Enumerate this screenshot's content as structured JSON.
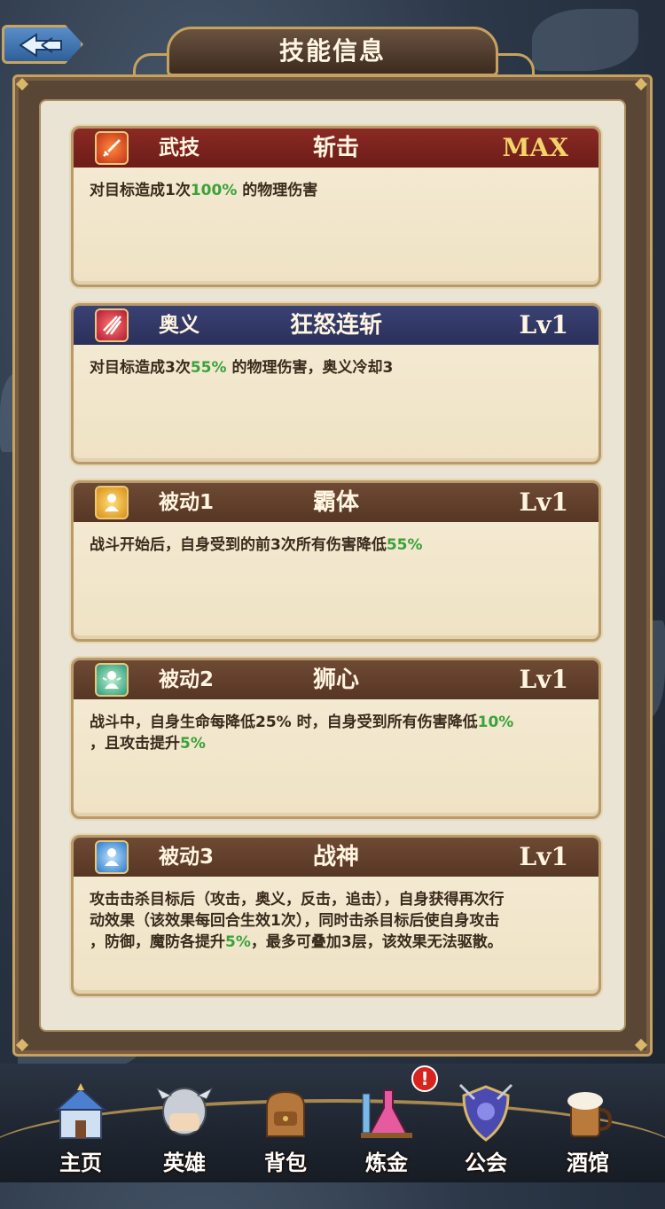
{
  "header": {
    "title": "技能信息"
  },
  "skills": [
    {
      "type": "武技",
      "name": "斩击",
      "level": "MAX",
      "header_color": "#7a221e",
      "icon": "sword-skill-icon",
      "desc": [
        {
          "t": "对目标造成1次"
        },
        {
          "t": "100%",
          "hl": true
        },
        {
          "t": " 的物理伤害"
        }
      ]
    },
    {
      "type": "奥义",
      "name": "狂怒连斩",
      "level": "Lv1",
      "header_color": "#323a68",
      "icon": "slash-skill-icon",
      "desc": [
        {
          "t": "对目标造成3次"
        },
        {
          "t": "55%",
          "hl": true
        },
        {
          "t": " 的物理伤害，奥义冷却3"
        }
      ]
    },
    {
      "type": "被动1",
      "name": "霸体",
      "level": "Lv1",
      "header_color": "#62402c",
      "icon": "super-armor-icon",
      "desc": [
        {
          "t": "战斗开始后，自身受到的前3次所有伤害降低"
        },
        {
          "t": "55%",
          "hl": true
        }
      ]
    },
    {
      "type": "被动2",
      "name": "狮心",
      "level": "Lv1",
      "header_color": "#62402c",
      "icon": "lion-heart-icon",
      "desc": [
        {
          "t": "战斗中，自身生命每降低25% 时，自身受到所有伤害降低"
        },
        {
          "t": "10%",
          "hl": true
        },
        {
          "t": "\n，且攻击提升"
        },
        {
          "t": "5%",
          "hl": true
        }
      ]
    },
    {
      "type": "被动3",
      "name": "战神",
      "level": "Lv1",
      "header_color": "#62402c",
      "icon": "war-god-icon",
      "desc": [
        {
          "t": "攻击击杀目标后（攻击，奥义，反击，追击），自身获得再次行\n动效果（该效果每回合生效1次），同时击杀目标后使自身攻击\n，防御，魔防各提升"
        },
        {
          "t": "5%",
          "hl": true
        },
        {
          "t": "，最多可叠加3层，该效果无法驱散。"
        }
      ]
    }
  ],
  "nav": {
    "items": [
      {
        "label": "主页",
        "icon": "home-castle-icon"
      },
      {
        "label": "英雄",
        "icon": "hero-helmet-icon"
      },
      {
        "label": "背包",
        "icon": "backpack-icon"
      },
      {
        "label": "炼金",
        "icon": "alchemy-flask-icon"
      },
      {
        "label": "公会",
        "icon": "guild-shield-icon"
      },
      {
        "label": "酒馆",
        "icon": "tavern-beer-icon"
      }
    ],
    "alert_badge": "!"
  },
  "colors": {
    "highlight": "#3aa23a",
    "gold": "#c7a25e",
    "max_level": "#f4d36a"
  }
}
